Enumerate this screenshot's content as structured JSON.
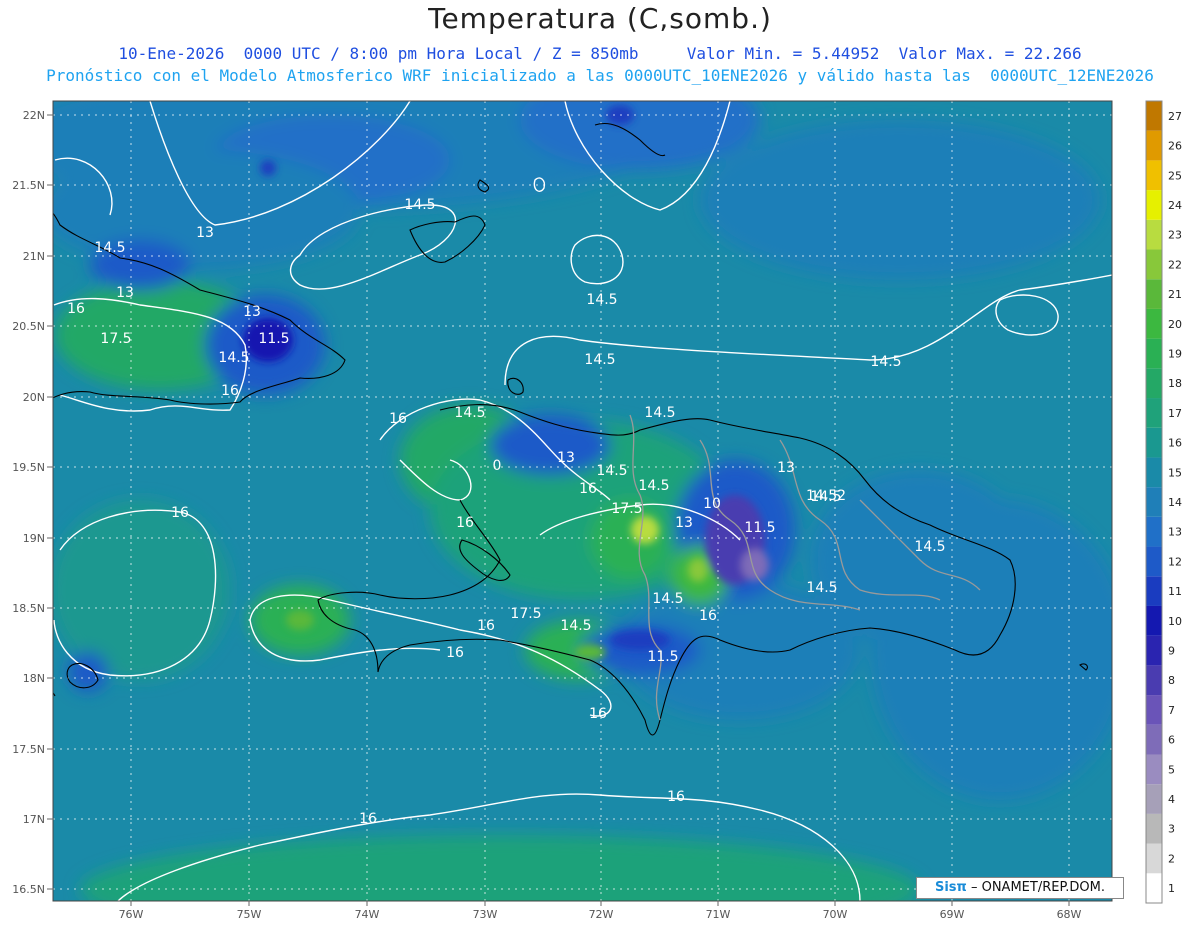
{
  "header": {
    "title": "Temperatura (C,somb.)",
    "line2": "10-Ene-2026  0000 UTC / 8:00 pm Hora Local / Z = 850mb     Valor Min. = 5.44952  Valor Max. = 22.266",
    "line3": "Pronóstico con el Modelo Atmosferico WRF inicializado a las 0000UTC_10ENE2026 y válido hasta las  0000UTC_12ENE2026"
  },
  "axes": {
    "lat_labels": [
      "22N",
      "21.5N",
      "21N",
      "20.5N",
      "20N",
      "19.5N",
      "19N",
      "18.5N",
      "18N",
      "17.5N",
      "17N",
      "16.5N"
    ],
    "lon_labels": [
      "76W",
      "75W",
      "74W",
      "73W",
      "72W",
      "71W",
      "70W",
      "69W",
      "68W"
    ]
  },
  "colorbar": {
    "labels": [
      "1",
      "2",
      "3",
      "4",
      "5",
      "6",
      "7",
      "8",
      "9",
      "10",
      "11",
      "12",
      "13",
      "14",
      "15",
      "16",
      "17",
      "18",
      "19",
      "20",
      "21",
      "22",
      "23",
      "24",
      "25",
      "26",
      "27"
    ],
    "colors": [
      "#ffffff",
      "#d8d8d8",
      "#b8b8b8",
      "#a6a0b8",
      "#9a8cc0",
      "#7e6cb8",
      "#6a54b8",
      "#4a3cb0",
      "#2a24b0",
      "#1418b0",
      "#1a3cc0",
      "#1e5ac8",
      "#2070c8",
      "#1f7fb8",
      "#1a8aa8",
      "#1a9890",
      "#1fa27a",
      "#24a866",
      "#2ab054",
      "#3cb840",
      "#5ab83a",
      "#88c83a",
      "#b8dc40",
      "#e6f000",
      "#f0c000",
      "#e09a00",
      "#c07800"
    ]
  },
  "contour_labels": [
    {
      "text": "13"
    },
    {
      "text": "14.5"
    },
    {
      "text": "14.5"
    },
    {
      "text": "13"
    },
    {
      "text": "16"
    },
    {
      "text": "17.5"
    },
    {
      "text": "13"
    },
    {
      "text": "11.5"
    },
    {
      "text": "14.5"
    },
    {
      "text": "16"
    },
    {
      "text": "14.5"
    },
    {
      "text": "14.5"
    },
    {
      "text": "14.5"
    },
    {
      "text": "16"
    },
    {
      "text": "14.5"
    },
    {
      "text": "14.5"
    },
    {
      "text": "13"
    },
    {
      "text": "14.5"
    },
    {
      "text": "13"
    },
    {
      "text": "14.5"
    },
    {
      "text": "16"
    },
    {
      "text": "14.5"
    },
    {
      "text": "17.5"
    },
    {
      "text": "10"
    },
    {
      "text": "13"
    },
    {
      "text": "11.5"
    },
    {
      "text": "14.52"
    },
    {
      "text": "16"
    },
    {
      "text": "16"
    },
    {
      "text": "14.5"
    },
    {
      "text": "14.5"
    },
    {
      "text": "14.5"
    },
    {
      "text": "17.5"
    },
    {
      "text": "16"
    },
    {
      "text": "14.5"
    },
    {
      "text": "16"
    },
    {
      "text": "16"
    },
    {
      "text": "11.5"
    },
    {
      "text": "16"
    },
    {
      "text": "16"
    },
    {
      "text": "16"
    },
    {
      "text": "0"
    }
  ],
  "credit": {
    "logo": "Sisπ",
    "text": "– ONAMET/REP.DOM."
  }
}
